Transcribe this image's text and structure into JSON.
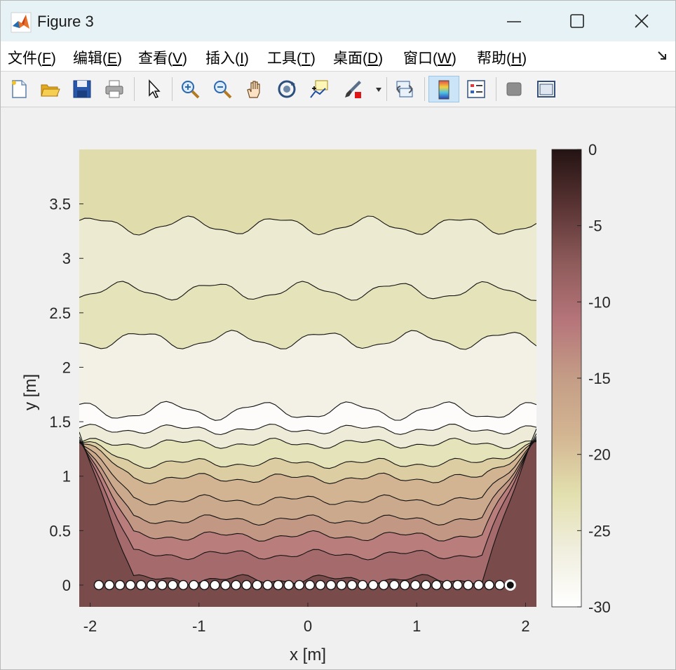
{
  "window": {
    "title": "Figure 3",
    "controls": [
      "minimize",
      "maximize",
      "close"
    ]
  },
  "menu": [
    {
      "text": "文件(",
      "key": "F",
      "end": ")"
    },
    {
      "text": "编辑(",
      "key": "E",
      "end": ")"
    },
    {
      "text": "查看(",
      "key": "V",
      "end": ")"
    },
    {
      "text": "插入(",
      "key": "I",
      "end": ")"
    },
    {
      "text": "工具(",
      "key": "T",
      "end": ")"
    },
    {
      "text": "桌面(",
      "key": "D",
      "end": ")"
    },
    {
      "text": "窗口(",
      "key": "W",
      "end": ")"
    },
    {
      "text": "帮助(",
      "key": "H",
      "end": ")"
    }
  ],
  "toolbar": {
    "icons": [
      "new-figure-icon",
      "open-file-icon",
      "save-icon",
      "print-icon",
      "select-arrow-icon",
      "zoom-in-icon",
      "zoom-out-icon",
      "pan-hand-icon",
      "rotate-3d-icon",
      "data-cursor-icon",
      "brush-icon",
      "link-plot-icon",
      "colorbar-icon",
      "legend-icon",
      "hide-tools-icon",
      "show-tools-icon"
    ],
    "active": "colorbar-icon"
  },
  "chart_data": {
    "type": "contourf",
    "xlabel": "x [m]",
    "ylabel": "y [m]",
    "xlim": [
      -2.1,
      2.1
    ],
    "ylim": [
      -0.2,
      4.0
    ],
    "xticks": [
      "-2",
      "-1",
      "0",
      "1",
      "2"
    ],
    "yticks": [
      "0",
      "0.5",
      "1",
      "1.5",
      "2",
      "2.5",
      "3",
      "3.5"
    ],
    "colorbar": {
      "range": [
        -30,
        0
      ],
      "ticks": [
        "0",
        "-5",
        "-10",
        "-15",
        "-20",
        "-25",
        "-30"
      ],
      "colormap": "pink-reversed",
      "stops": [
        "#ffffff",
        "#f0eede",
        "#e2dfad",
        "#d3b592",
        "#c49d86",
        "#b6757a",
        "#8f5b5b",
        "#5a3434",
        "#241313"
      ]
    },
    "contour_levels_y": [
      0.05,
      0.28,
      0.45,
      0.6,
      0.78,
      0.98,
      1.12,
      1.3,
      1.43,
      1.6,
      2.25,
      2.7,
      3.3
    ],
    "array": {
      "element_count": 40,
      "x_start": -1.92,
      "x_end": 1.86,
      "y": 0,
      "marker": "white-circle",
      "last_marker": "black-dot"
    }
  }
}
